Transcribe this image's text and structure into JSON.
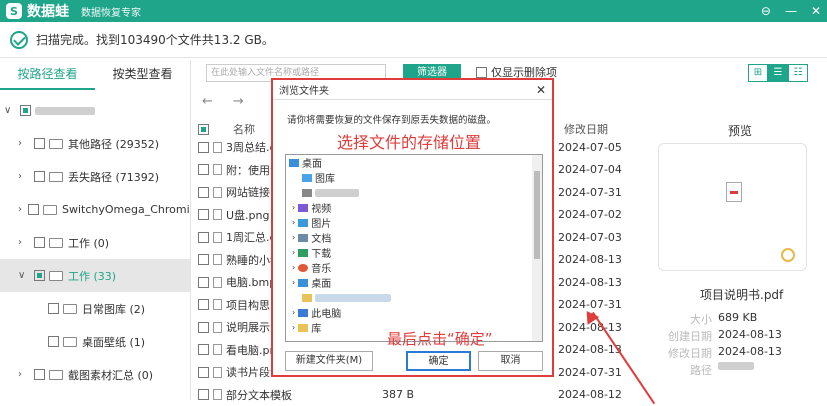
{
  "app": {
    "logo_char": "S",
    "name": "数据蛙",
    "subtitle": "数据恢复专家",
    "ctrl_menu": "⊖",
    "ctrl_min": "—",
    "ctrl_close": "✕"
  },
  "status": {
    "text": "扫描完成。找到103490个文件共13.2 GB。"
  },
  "left_tabs": {
    "by_path": "按路径查看",
    "by_type": "按类型查看"
  },
  "tree": [
    {
      "label": "",
      "blurred": true
    },
    {
      "label": "其他路径 (29352)"
    },
    {
      "label": "丢失路径 (71392)"
    },
    {
      "label": "SwitchyOmega_Chromium"
    },
    {
      "label": "工作 (0)"
    },
    {
      "label": "工作 (33)"
    },
    {
      "label": "日常图库 (2)"
    },
    {
      "label": "桌面壁纸 (1)"
    },
    {
      "label": "截图素材汇总 (0)"
    }
  ],
  "toolbar": {
    "search_placeholder": "在此处输入文件名称或路径",
    "filter": "筛选器",
    "show_deleted": "仅显示删除项"
  },
  "view_toggle": [
    "⊞",
    "☰",
    "☷"
  ],
  "nav": {
    "back": "←",
    "forward": "→"
  },
  "table": {
    "col_name": "名称",
    "col_date": "修改日期",
    "rows": [
      {
        "name": "3周总结.d",
        "size": "",
        "date": "2024-07-05"
      },
      {
        "name": "附：使用注",
        "size": "",
        "date": "2024-07-04"
      },
      {
        "name": "网站链接.t",
        "size": "",
        "date": "2024-07-31"
      },
      {
        "name": "U盘.png",
        "size": "",
        "date": "2024-07-02"
      },
      {
        "name": "1周汇总.d",
        "size": "",
        "date": "2024-07-03"
      },
      {
        "name": "熟睡的小猪",
        "size": "",
        "date": "2024-08-13"
      },
      {
        "name": "电脑.bmp",
        "size": "",
        "date": "2024-08-13"
      },
      {
        "name": "项目构思.d",
        "size": "",
        "date": "2024-07-31"
      },
      {
        "name": "说明展示.p",
        "size": "",
        "date": "2024-08-13"
      },
      {
        "name": "看电脑.png",
        "size": "",
        "date": "2024-08-13"
      },
      {
        "name": "读书片段证",
        "size": "",
        "date": "2024-07-31"
      },
      {
        "name": "部分文本模板...",
        "size": "387 B",
        "date": "2024-08-12"
      }
    ]
  },
  "preview": {
    "title": "预览",
    "file_name": "项目说明书.pdf",
    "size_label": "大小",
    "size": "689 KB",
    "created_label": "创建日期",
    "created": "2024-08-13",
    "modified_label": "修改日期",
    "modified": "2024-08-13",
    "path_label": "路径"
  },
  "dialog": {
    "title": "浏览文件夹",
    "close": "✕",
    "message": "请你将需要恢复的文件保存到原丢失数据的磁盘。",
    "hint_top": "选择文件的存储位置",
    "hint_bottom": "最后点击“确定”",
    "tree": [
      {
        "label": "桌面"
      },
      {
        "label": "图库"
      },
      {
        "label": "",
        "blurred": true
      },
      {
        "label": "视频"
      },
      {
        "label": "图片"
      },
      {
        "label": "文档"
      },
      {
        "label": "下载"
      },
      {
        "label": "音乐"
      },
      {
        "label": "桌面"
      },
      {
        "label": "",
        "blurred": true
      },
      {
        "label": "此电脑"
      },
      {
        "label": "库"
      }
    ],
    "btn_new": "新建文件夹(M)",
    "btn_ok": "确定",
    "btn_cancel": "取消"
  },
  "colors": {
    "brand": "#1fa58a",
    "annotation": "#e03c3c",
    "focus": "#2a7ad6"
  }
}
